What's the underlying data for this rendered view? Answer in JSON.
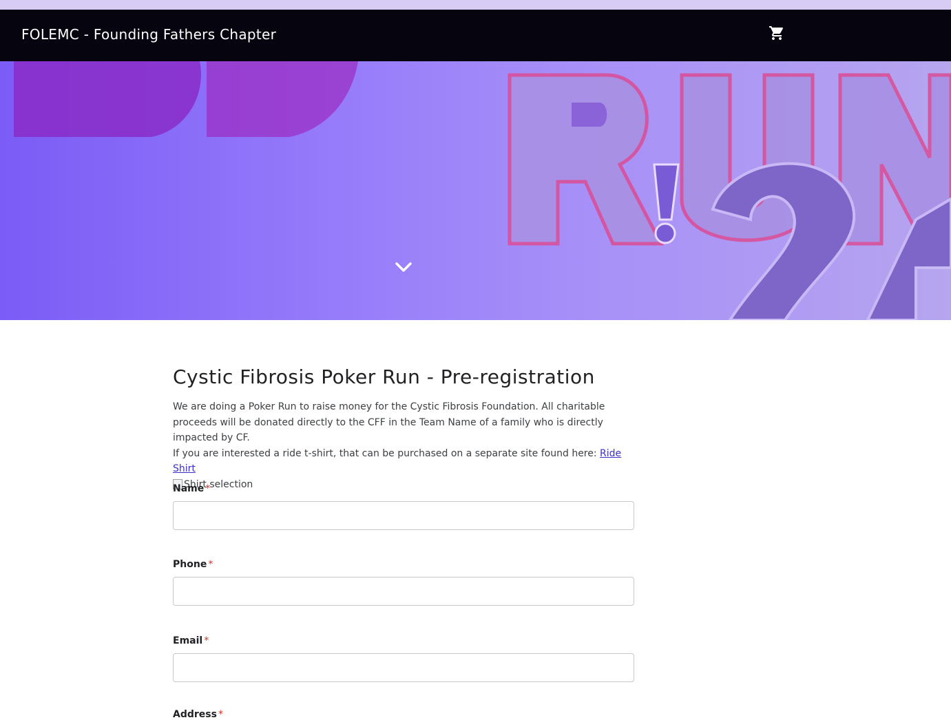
{
  "navbar": {
    "brand": "FOLEMC - Founding Fathers Chapter",
    "cart_icon": "cart-icon"
  },
  "hero": {
    "expand_icon": "chevron-down-icon"
  },
  "page": {
    "title": "Cystic Fibrosis Poker Run - Pre-registration",
    "description_1": "We are doing a Poker Run to raise money for the Cystic Fibrosis Foundation. All charitable proceeds will be donated directly to the CFF in the Team Name of a family who is directly impacted by CF.",
    "description_2": "If you are interested a ride t-shirt, that can be purchased on a separate site found here:",
    "ride_shirt_link": "Ride Shirt",
    "shirt_image_alt": "Shirt selection"
  },
  "form": {
    "required_marker": "*",
    "fields": [
      {
        "label": "Name",
        "value": ""
      },
      {
        "label": "Phone",
        "value": ""
      },
      {
        "label": "Email",
        "value": ""
      },
      {
        "label": "Address",
        "value": ""
      }
    ]
  },
  "colors": {
    "navbar": "#06050f",
    "accent_link": "#3b2fc9",
    "required": "#d93025",
    "hero_start": "#7b5cf6",
    "hero_end": "#b6a5ef"
  }
}
